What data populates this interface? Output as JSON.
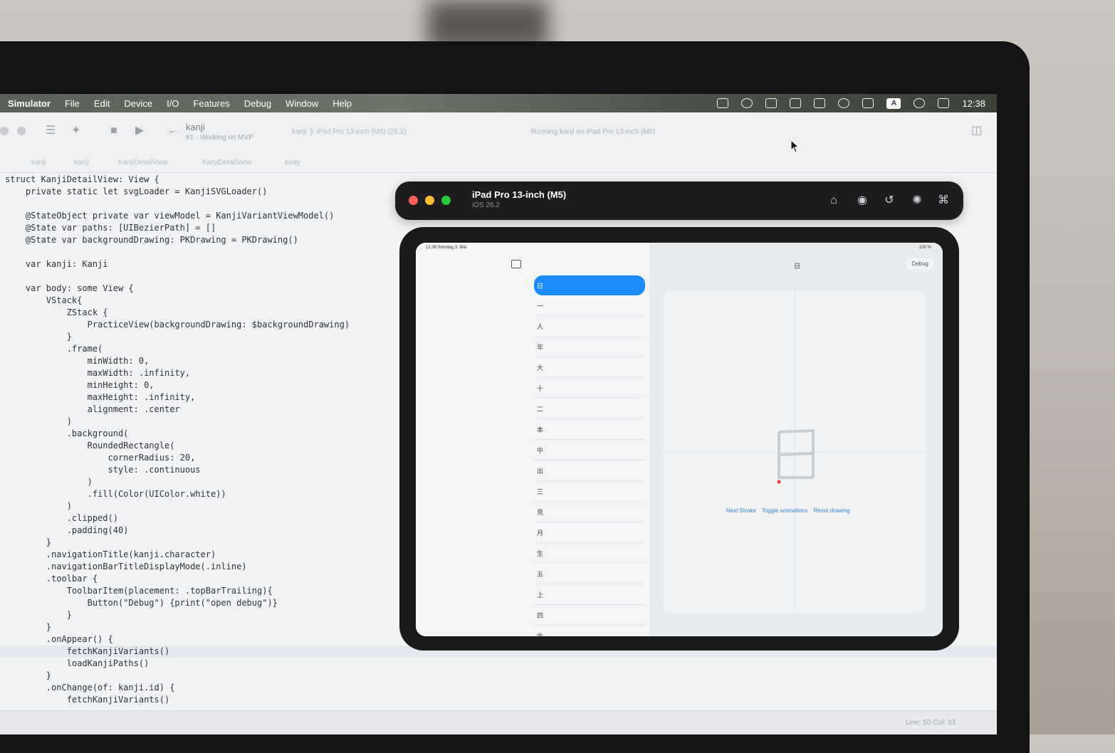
{
  "menubar": {
    "app": "Simulator",
    "items": [
      "File",
      "Edit",
      "Device",
      "I/O",
      "Features",
      "Debug",
      "Window",
      "Help"
    ],
    "clock": "12:38",
    "input_badge": "A"
  },
  "toolbar": {
    "scheme": "kanji",
    "scheme_sub": "#1 - Working on MVP",
    "destination": "kanji  ❭  iPad Pro 13-inch (M5) (26.2)",
    "status": "Running kanji on iPad Pro 13-inch (M5)"
  },
  "jumpbar": [
    "kanji",
    "kanji",
    "KanjiDetailView",
    "KanjiDetailView",
    "body"
  ],
  "code_lines": [
    "struct KanjiDetailView: View {",
    "    private static let svgLoader = KanjiSVGLoader()",
    "",
    "    @StateObject private var viewModel = KanjiVariantViewModel()",
    "    @State var paths: [UIBezierPath] = []",
    "    @State var backgroundDrawing: PKDrawing = PKDrawing()",
    "",
    "    var kanji: Kanji",
    "",
    "    var body: some View {",
    "        VStack{",
    "            ZStack {",
    "                PracticeView(backgroundDrawing: $backgroundDrawing)",
    "            }",
    "            .frame(",
    "                minWidth: 0,",
    "                maxWidth: .infinity,",
    "                minHeight: 0,",
    "                maxHeight: .infinity,",
    "                alignment: .center",
    "            )",
    "            .background(",
    "                RoundedRectangle(",
    "                    cornerRadius: 20,",
    "                    style: .continuous",
    "                )",
    "                .fill(Color(UIColor.white))",
    "            )",
    "            .clipped()",
    "            .padding(40)",
    "        }",
    "        .navigationTitle(kanji.character)",
    "        .navigationBarTitleDisplayMode(.inline)",
    "        .toolbar {",
    "            ToolbarItem(placement: .topBarTrailing){",
    "                Button(\"Debug\") {print(\"open debug\")}",
    "            }",
    "        }",
    "        .onAppear() {",
    "            fetchKanjiVariants()",
    "            loadKanjiPaths()",
    "        }",
    "        .onChange(of: kanji.id) {",
    "            fetchKanjiVariants()"
  ],
  "highlight_line": 39,
  "cursor_position": "Line: 50  Col: 33",
  "simulator": {
    "device": "iPad Pro 13-inch (M5)",
    "os": "iOS 26.2",
    "status_time": "12:38  Sonntag 3. Mai",
    "battery": "100 %",
    "kanji_list": [
      "日",
      "一",
      "人",
      "年",
      "大",
      "十",
      "二",
      "本",
      "中",
      "出",
      "三",
      "見",
      "月",
      "生",
      "五",
      "上",
      "四",
      "金"
    ],
    "selected_index": 0,
    "detail_title": "日",
    "debug_button": "Debug",
    "actions": [
      "Next Stroke",
      "Toggle animations",
      "Reset drawing"
    ]
  }
}
